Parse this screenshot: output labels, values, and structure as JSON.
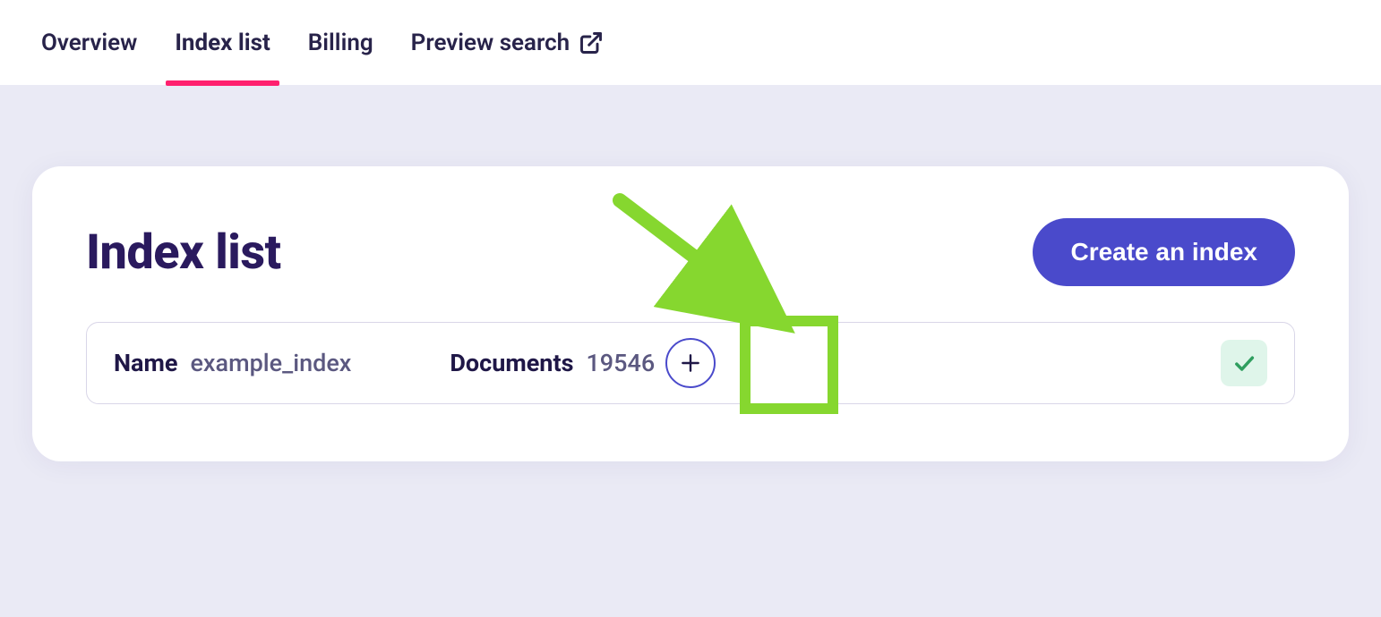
{
  "tabs": [
    {
      "label": "Overview",
      "active": false,
      "external": false
    },
    {
      "label": "Index list",
      "active": true,
      "external": false
    },
    {
      "label": "Billing",
      "active": false,
      "external": false
    },
    {
      "label": "Preview search",
      "active": false,
      "external": true
    }
  ],
  "page": {
    "title": "Index list",
    "create_button": "Create an index"
  },
  "index_row": {
    "name_label": "Name",
    "name_value": "example_index",
    "docs_label": "Documents",
    "docs_value": "19546"
  },
  "icons": {
    "external": "external-link-icon",
    "plus": "plus-icon",
    "check": "check-icon"
  }
}
